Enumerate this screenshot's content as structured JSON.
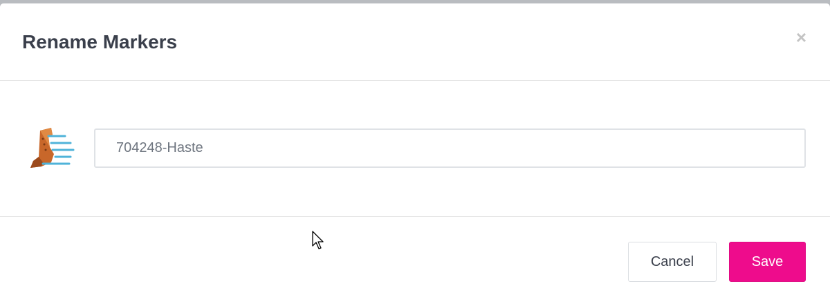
{
  "modal": {
    "title": "Rename Markers",
    "close_label": "×"
  },
  "marker": {
    "icon": "haste-boot-icon",
    "name_value": "704248-Haste"
  },
  "footer": {
    "cancel_label": "Cancel",
    "save_label": "Save"
  },
  "colors": {
    "save_button": "#ee0c8c",
    "title_text": "#3a3f4b",
    "boot_primary": "#c8672a",
    "speed_lines": "#4fb3d9"
  }
}
